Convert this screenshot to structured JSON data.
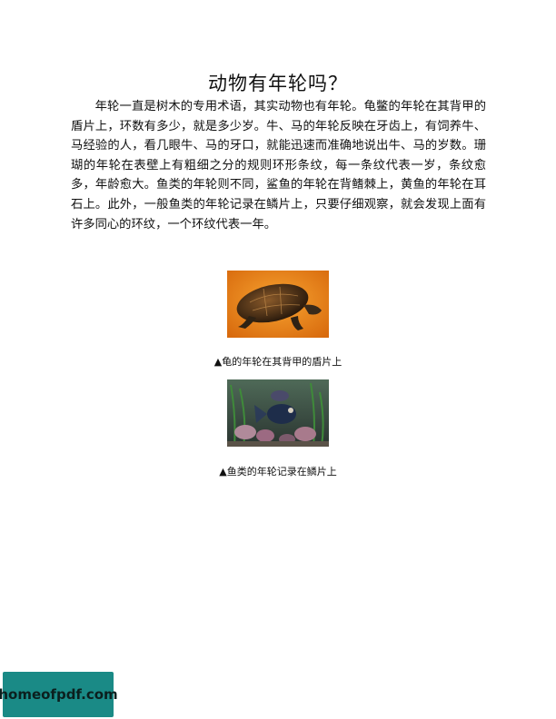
{
  "page": {
    "title": "动物有年轮吗？",
    "paragraph": "年轮一直是树木的专用术语，其实动物也有年轮。龟鳖的年轮在其背甲的盾片上，环数有多少，就是多少岁。牛、马的年轮反映在牙齿上，有饲养牛、马经验的人，看几眼牛、马的牙口，就能迅速而准确地说出牛、马的岁数。珊瑚的年轮在表壁上有粗细之分的规则环形条纹，每一条纹代表一岁，条纹愈多，年龄愈大。鱼类的年轮则不同，鲨鱼的年轮在背鳍棘上，黄鱼的年轮在耳石上。此外，一般鱼类的年轮记录在鳞片上，只要仔细观察，就会发现上面有许多同心的环纹，一个环纹代表一年。"
  },
  "figures": [
    {
      "caption": "▲龟的年轮在其背甲的盾片上"
    },
    {
      "caption": "▲鱼类的年轮记录在鳞片上"
    }
  ],
  "watermark": {
    "text": "homeofpdf.com"
  }
}
